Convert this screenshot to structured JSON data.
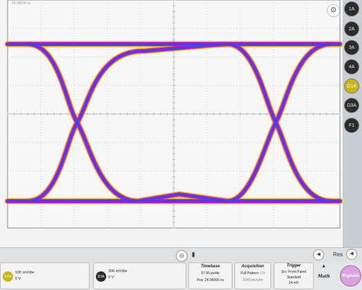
{
  "scope": {
    "timestamp": "24.08006 ns"
  },
  "channels": [
    {
      "label": "1A",
      "active": false
    },
    {
      "label": "2A",
      "active": false
    },
    {
      "label": "3A",
      "active": false
    },
    {
      "label": "4A",
      "active": false
    },
    {
      "label": "D1A",
      "active": true
    },
    {
      "label": "D3A",
      "active": false
    },
    {
      "label": "F1",
      "active": false
    }
  ],
  "scrollbar": {
    "reset_label": "Res"
  },
  "bottom": {
    "ch1": {
      "badge": "D1A",
      "scale": "100 mV/div",
      "offset": "0 V"
    },
    "ch2": {
      "badge": "D3A",
      "scale": "200 mV/div",
      "offset": "0 V"
    },
    "timebase": {
      "title": "Timebase",
      "line1": "37.05 ps/div",
      "line2": "Pos: 24.08006 ns"
    },
    "acquisition": {
      "title": "Acquisition",
      "line1_a": "Full Pattern: ",
      "line1_b": "Off",
      "line2": "2048 pts/wfm"
    },
    "trigger": {
      "title": "Trigger",
      "line1": "Src: Front Panel",
      "line2": "Standard",
      "line3": "24 mV"
    },
    "math_label": "Math",
    "signals_label": "Signals"
  },
  "colors": {
    "trace_outer": "#e2b61a",
    "trace_mid": "#b71fc3",
    "trace_core": "#3e44e8",
    "active_channel": "#c7b31a"
  }
}
